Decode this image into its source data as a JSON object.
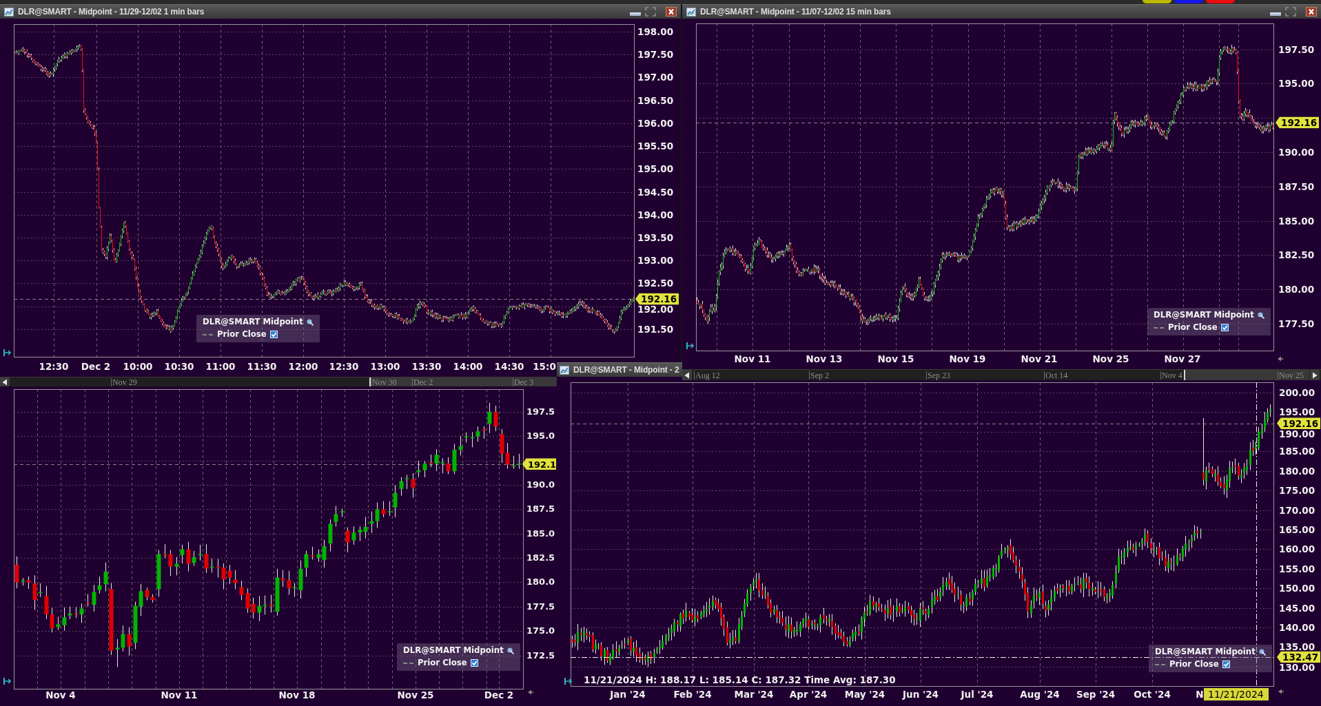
{
  "top_strip": {
    "color_tabs": [
      {
        "color": "#bdb800"
      },
      {
        "color": "#1616e8"
      },
      {
        "color": "#e80e0e"
      }
    ]
  },
  "top_left_chart": {
    "title": "DLR@SMART - Midpoint - 11/29-12/02 1 min bars",
    "price_labels": [
      "198.00",
      "197.50",
      "197.00",
      "196.50",
      "196.00",
      "195.50",
      "195.00",
      "194.50",
      "194.00",
      "193.50",
      "193.00",
      "192.50",
      "192.00",
      "191.50"
    ],
    "time_labels": [
      "12:30",
      "Dec 2",
      "10:00",
      "10:30",
      "11:00",
      "11:30",
      "12:00",
      "12:30",
      "13:00",
      "13:30",
      "14:00",
      "14:30",
      "15:0"
    ],
    "price_tag": "192.16",
    "legend": {
      "title": "DLR@SMART Midpoint",
      "line": "Prior Close",
      "checked": true
    },
    "navigator": {
      "labels": [
        "Nov 29",
        "Nov 30",
        "Dec 2",
        "Dec 3"
      ]
    }
  },
  "top_right_chart": {
    "title": "DLR@SMART - Midpoint - 11/07-12/02 15 min bars",
    "price_labels": [
      "197.50",
      "195.00",
      "190.00",
      "187.50",
      "185.00",
      "182.50",
      "180.00",
      "177.50"
    ],
    "time_labels": [
      "Nov 11",
      "Nov 13",
      "Nov 15",
      "Nov 19",
      "Nov 21",
      "Nov 25",
      "Nov 27"
    ],
    "price_tag": "192.16",
    "legend": {
      "title": "DLR@SMART Midpoint",
      "line": "Prior Close",
      "checked": true
    },
    "navigator": {
      "labels": [
        "Aug 12",
        "Sep 2",
        "Sep 23",
        "Oct 14",
        "Nov 4",
        "Nov 25"
      ]
    }
  },
  "bottom_left_chart": {
    "price_labels": [
      "197.5",
      "195.0",
      "190.0",
      "187.5",
      "185.0",
      "182.5",
      "180.0",
      "177.5",
      "175.0",
      "172.5"
    ],
    "time_labels": [
      "Nov 4",
      "Nov 11",
      "Nov 18",
      "Nov 25",
      "Dec 2"
    ],
    "price_tag": "192.1",
    "legend": {
      "title": "DLR@SMART Midpoint",
      "line": "Prior Close",
      "checked": true
    }
  },
  "bottom_right_chart": {
    "title": "DLR@SMART - Midpoint - 2",
    "price_labels": [
      "200.00",
      "195.00",
      "190.00",
      "185.00",
      "180.00",
      "175.00",
      "170.00",
      "165.00",
      "160.00",
      "155.00",
      "150.00",
      "145.00",
      "140.00",
      "135.00",
      "130.00"
    ],
    "time_labels": [
      "Jan '24",
      "Feb '24",
      "Mar '24",
      "Apr '24",
      "May '24",
      "Jun '24",
      "Jul '24",
      "Aug '24",
      "Sep '24",
      "Oct '24",
      "N"
    ],
    "price_tag": "192.16",
    "crosshair": {
      "price": "132.47",
      "date": "11/21/2024"
    },
    "readout": "11/21/2024 H: 188.17 L: 185.14 C: 187.32 Time Avg: 187.30",
    "legend": {
      "title": "DLR@SMART Midpoint",
      "line": "Prior Close",
      "checked": true
    }
  }
}
